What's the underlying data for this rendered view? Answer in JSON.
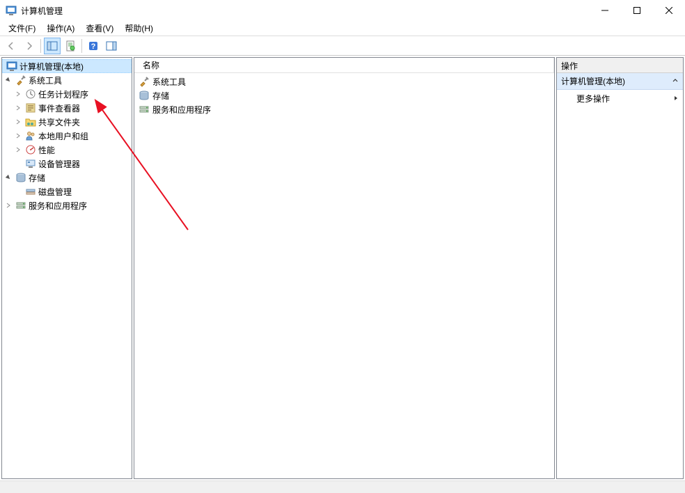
{
  "window": {
    "title": "计算机管理"
  },
  "menu": {
    "file": "文件(F)",
    "action": "操作(A)",
    "view": "查看(V)",
    "help": "帮助(H)"
  },
  "tree": {
    "root": "计算机管理(本地)",
    "system_tools": "系统工具",
    "task_scheduler": "任务计划程序",
    "event_viewer": "事件查看器",
    "shared_folders": "共享文件夹",
    "local_users": "本地用户和组",
    "performance": "性能",
    "device_manager": "设备管理器",
    "storage": "存储",
    "disk_mgmt": "磁盘管理",
    "services_apps": "服务和应用程序"
  },
  "list": {
    "header_name": "名称",
    "items": [
      "系统工具",
      "存储",
      "服务和应用程序"
    ]
  },
  "actions": {
    "header": "操作",
    "section": "计算机管理(本地)",
    "more": "更多操作"
  }
}
